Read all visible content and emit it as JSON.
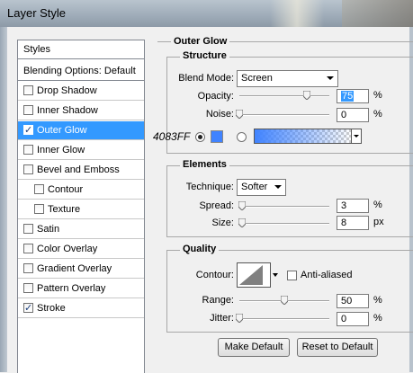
{
  "window": {
    "title": "Layer Style"
  },
  "styles_list": {
    "header": "Styles",
    "blending": "Blending Options: Default",
    "items": [
      {
        "label": "Drop Shadow",
        "checked": false,
        "active": false,
        "indent": false
      },
      {
        "label": "Inner Shadow",
        "checked": false,
        "active": false,
        "indent": false
      },
      {
        "label": "Outer Glow",
        "checked": true,
        "active": true,
        "indent": false
      },
      {
        "label": "Inner Glow",
        "checked": false,
        "active": false,
        "indent": false
      },
      {
        "label": "Bevel and Emboss",
        "checked": false,
        "active": false,
        "indent": false
      },
      {
        "label": "Contour",
        "checked": false,
        "active": false,
        "indent": true
      },
      {
        "label": "Texture",
        "checked": false,
        "active": false,
        "indent": true
      },
      {
        "label": "Satin",
        "checked": false,
        "active": false,
        "indent": false
      },
      {
        "label": "Color Overlay",
        "checked": false,
        "active": false,
        "indent": false
      },
      {
        "label": "Gradient Overlay",
        "checked": false,
        "active": false,
        "indent": false
      },
      {
        "label": "Pattern Overlay",
        "checked": false,
        "active": false,
        "indent": false
      },
      {
        "label": "Stroke",
        "checked": true,
        "active": false,
        "indent": false
      }
    ]
  },
  "outer_glow": {
    "title": "Outer Glow",
    "structure": {
      "title": "Structure",
      "blend_mode_label": "Blend Mode:",
      "blend_mode_value": "Screen",
      "opacity_label": "Opacity:",
      "opacity_value": "75",
      "opacity_unit": "%",
      "opacity_level": 75,
      "noise_label": "Noise:",
      "noise_value": "0",
      "noise_unit": "%",
      "noise_level": 0,
      "color_hex_annotation": "4083FF",
      "glow_color": "#4083ff"
    },
    "elements": {
      "title": "Elements",
      "technique_label": "Technique:",
      "technique_value": "Softer",
      "spread_label": "Spread:",
      "spread_value": "3",
      "spread_unit": "%",
      "spread_level": 3,
      "size_label": "Size:",
      "size_value": "8",
      "size_unit": "px",
      "size_level": 3
    },
    "quality": {
      "title": "Quality",
      "contour_label": "Contour:",
      "antialiased_label": "Anti-aliased",
      "range_label": "Range:",
      "range_value": "50",
      "range_unit": "%",
      "range_level": 50,
      "jitter_label": "Jitter:",
      "jitter_value": "0",
      "jitter_unit": "%",
      "jitter_level": 0
    },
    "buttons": {
      "make_default": "Make Default",
      "reset_default": "Reset to Default"
    }
  },
  "colors": {
    "selection": "#3399ff",
    "glow": "#4083ff"
  }
}
